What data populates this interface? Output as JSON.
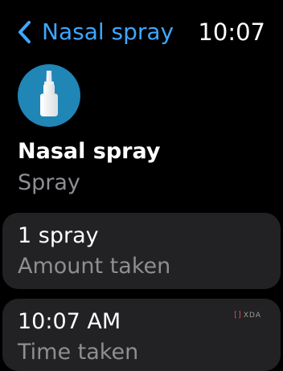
{
  "header": {
    "back_label": "Nasal spray",
    "time": "10:07"
  },
  "medication": {
    "icon": "nasal-spray-bottle-icon",
    "name": "Nasal spray",
    "form": "Spray"
  },
  "amount_card": {
    "value": "1 spray",
    "caption": "Amount taken"
  },
  "time_card": {
    "value": "10:07 AM",
    "caption": "Time taken"
  },
  "watermark": {
    "text": "XDA"
  },
  "colors": {
    "accent": "#3fa7ff",
    "icon_background": "#1f86b6",
    "card_background": "#222224",
    "secondary_text": "#8e8e93"
  }
}
